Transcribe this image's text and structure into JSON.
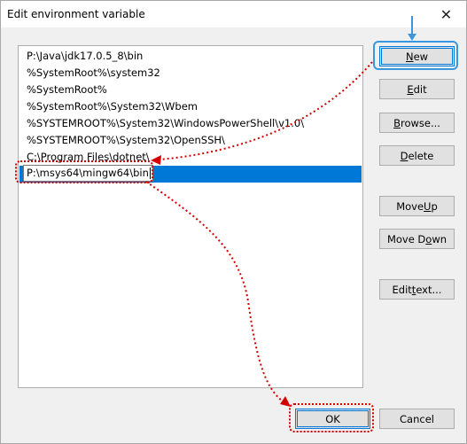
{
  "window": {
    "title": "Edit environment variable",
    "close_glyph": "✕"
  },
  "list": {
    "items": [
      "P:\\Java\\jdk17.0.5_8\\bin",
      "%SystemRoot%\\system32",
      "%SystemRoot%",
      "%SystemRoot%\\System32\\Wbem",
      "%SYSTEMROOT%\\System32\\WindowsPowerShell\\v1.0\\",
      "%SYSTEMROOT%\\System32\\OpenSSH\\",
      "C:\\Program Files\\dotnet\\"
    ],
    "editing_value": "P:\\msys64\\mingw64\\bin"
  },
  "buttons": {
    "new": {
      "accel": "N",
      "rest": "ew"
    },
    "edit": {
      "accel": "E",
      "rest": "dit"
    },
    "browse": {
      "pre": "",
      "accel": "B",
      "rest": "rowse..."
    },
    "delete": {
      "accel": "D",
      "rest": "elete"
    },
    "move_up": {
      "pre": "Move ",
      "accel": "U",
      "rest": "p"
    },
    "move_down": {
      "pre": "Move D",
      "accel": "o",
      "rest": "wn"
    },
    "edit_text": {
      "pre": "Edit ",
      "accel": "t",
      "rest": "ext..."
    },
    "ok": "OK",
    "cancel": "Cancel"
  },
  "annotation_colors": {
    "blue": "#3a96dd",
    "red": "#d40000",
    "selection": "#0078d7"
  }
}
